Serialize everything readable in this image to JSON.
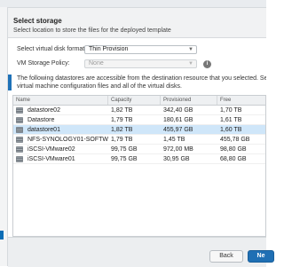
{
  "header": {
    "title": "Select storage",
    "subtitle": "Select location to store the files for the deployed template"
  },
  "form": {
    "disk_format_label": "Select virtual disk format:",
    "disk_format_value": "Thin Provision",
    "vm_storage_policy_label": "VM Storage Policy:",
    "vm_storage_policy_value": "None"
  },
  "notice": {
    "line1": "The following datastores are accessible from the destination resource that you selected. Select the",
    "line2": "virtual machine configuration files and all of the virtual disks."
  },
  "table": {
    "columns": [
      "Name",
      "Capacity",
      "Provisioned",
      "Free"
    ],
    "rows": [
      {
        "name": "datastore02",
        "capacity": "1,82 TB",
        "provisioned": "342,40 GB",
        "free": "1,70 TB",
        "icon": "datastore-icon",
        "selected": false
      },
      {
        "name": "Datastore",
        "capacity": "1,79 TB",
        "provisioned": "180,61 GB",
        "free": "1,61 TB",
        "icon": "datastore-icon",
        "selected": false
      },
      {
        "name": "datastore01",
        "capacity": "1,82 TB",
        "provisioned": "455,97 GB",
        "free": "1,60 TB",
        "icon": "datastore-icon",
        "selected": true
      },
      {
        "name": "NFS-SYNOLOGY01-SOFTW...",
        "capacity": "1,79 TB",
        "provisioned": "1,45 TB",
        "free": "455,78 GB",
        "icon": "datastore-icon",
        "selected": false
      },
      {
        "name": "iSCSI-VMware02",
        "capacity": "99,75 GB",
        "provisioned": "972,00 MB",
        "free": "98,80 GB",
        "icon": "datastore-icon",
        "selected": false
      },
      {
        "name": "iSCSI-VMware01",
        "capacity": "99,75 GB",
        "provisioned": "30,95 GB",
        "free": "68,80 GB",
        "icon": "datastore-icon",
        "selected": false
      }
    ]
  },
  "footer": {
    "back_label": "Back",
    "next_label": "Ne"
  },
  "colors": {
    "accent": "#1f6fb4",
    "selected_row": "#cfe6f9"
  }
}
